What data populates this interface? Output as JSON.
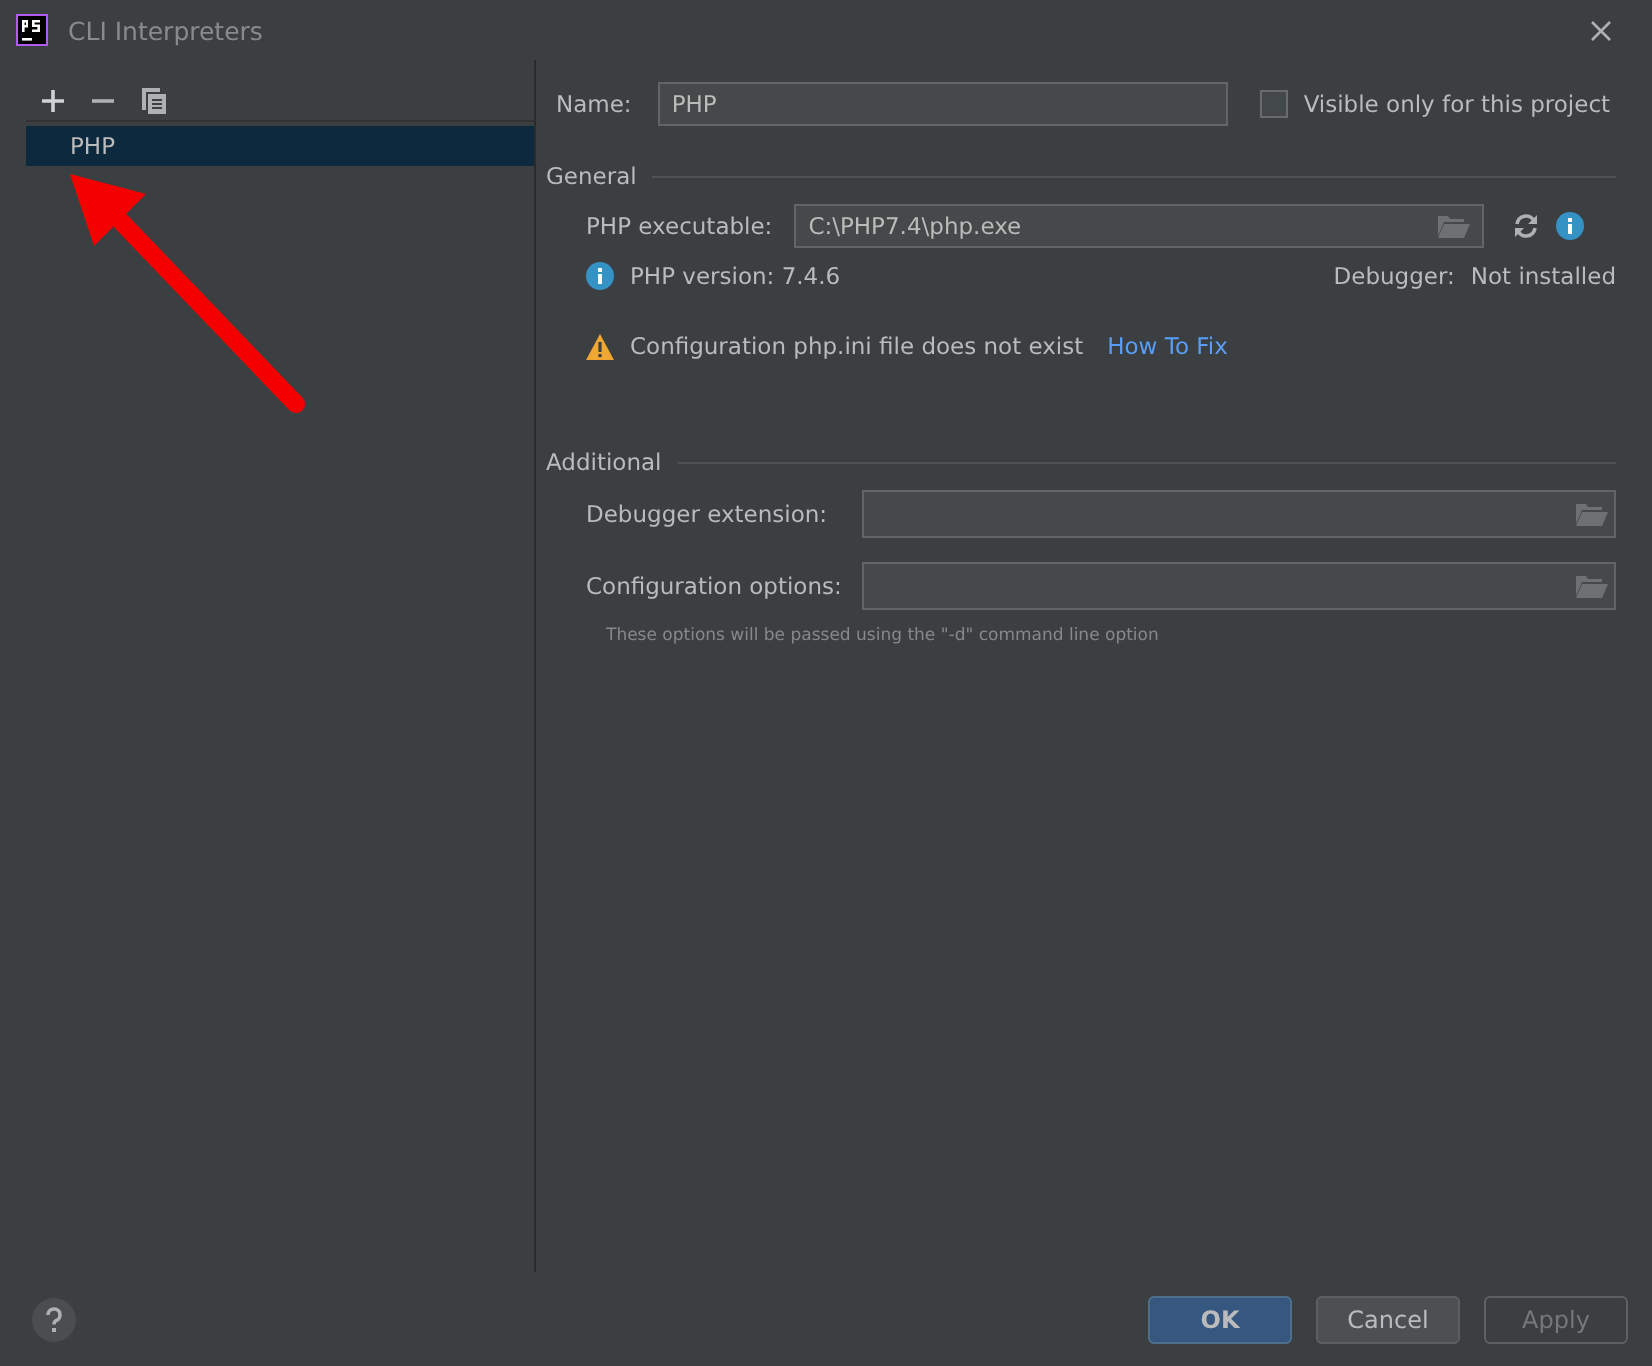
{
  "window": {
    "title": "CLI Interpreters"
  },
  "toolbar": [
    {
      "kind": "add"
    },
    {
      "kind": "remove"
    },
    {
      "kind": "copy"
    }
  ],
  "interpreters": [
    {
      "label": "PHP",
      "selected": true
    }
  ],
  "name_field": {
    "label": "Name:",
    "value": "PHP"
  },
  "visible_only": {
    "label": "Visible only for this project",
    "checked": false
  },
  "general": {
    "heading": "General",
    "executable_label": "PHP executable:",
    "executable_value": "C:\\PHP7.4\\php.exe",
    "version": "PHP version: 7.4.6",
    "debugger_label": "Debugger:",
    "debugger_value": "Not installed",
    "warning": "Configuration php.ini file does not exist",
    "fix_link": "How To Fix"
  },
  "additional": {
    "heading": "Additional",
    "fields": [
      {
        "label": "Debugger extension:"
      },
      {
        "label": "Configuration options:"
      }
    ],
    "hint": "These options will be passed using the \"-d\" command line option"
  },
  "buttons": [
    {
      "label": "OK",
      "kind": "default",
      "disabled": false
    },
    {
      "label": "Cancel",
      "kind": "normal",
      "disabled": false
    },
    {
      "label": "Apply",
      "kind": "normal",
      "disabled": true
    }
  ]
}
